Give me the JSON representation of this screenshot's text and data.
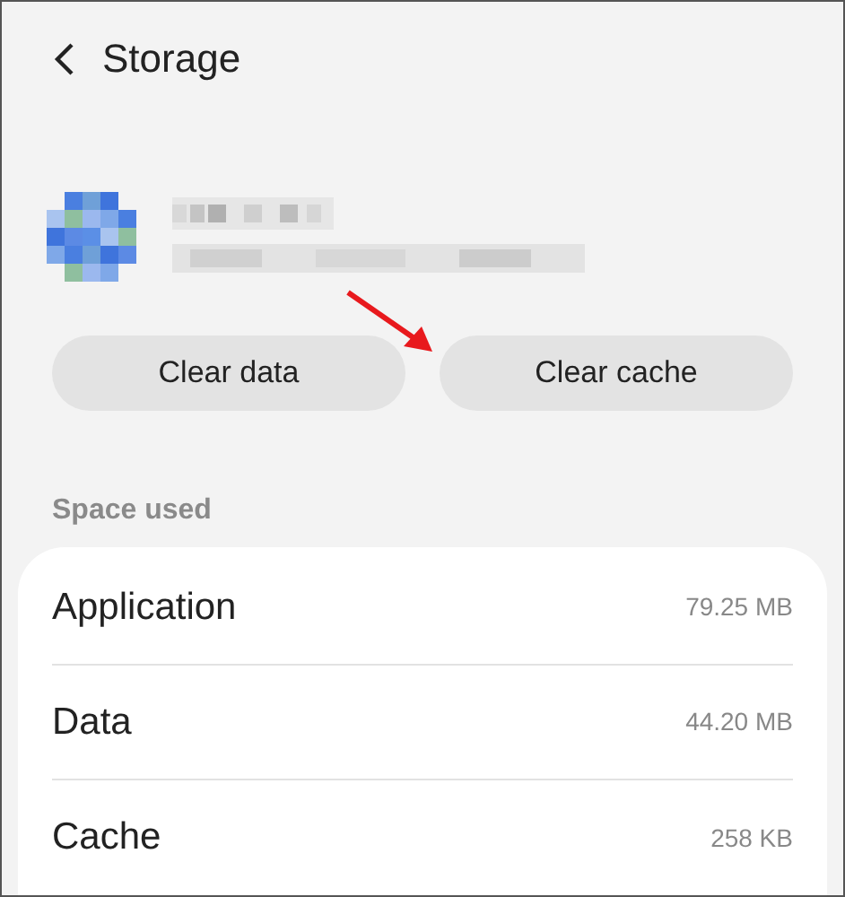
{
  "header": {
    "title": "Storage"
  },
  "buttons": [
    {
      "label": "Clear data"
    },
    {
      "label": "Clear cache"
    }
  ],
  "section": {
    "title": "Space used"
  },
  "rows": [
    {
      "name": "Application",
      "value": "79.25 MB"
    },
    {
      "name": "Data",
      "value": "44.20 MB"
    },
    {
      "name": "Cache",
      "value": "258 KB"
    }
  ]
}
